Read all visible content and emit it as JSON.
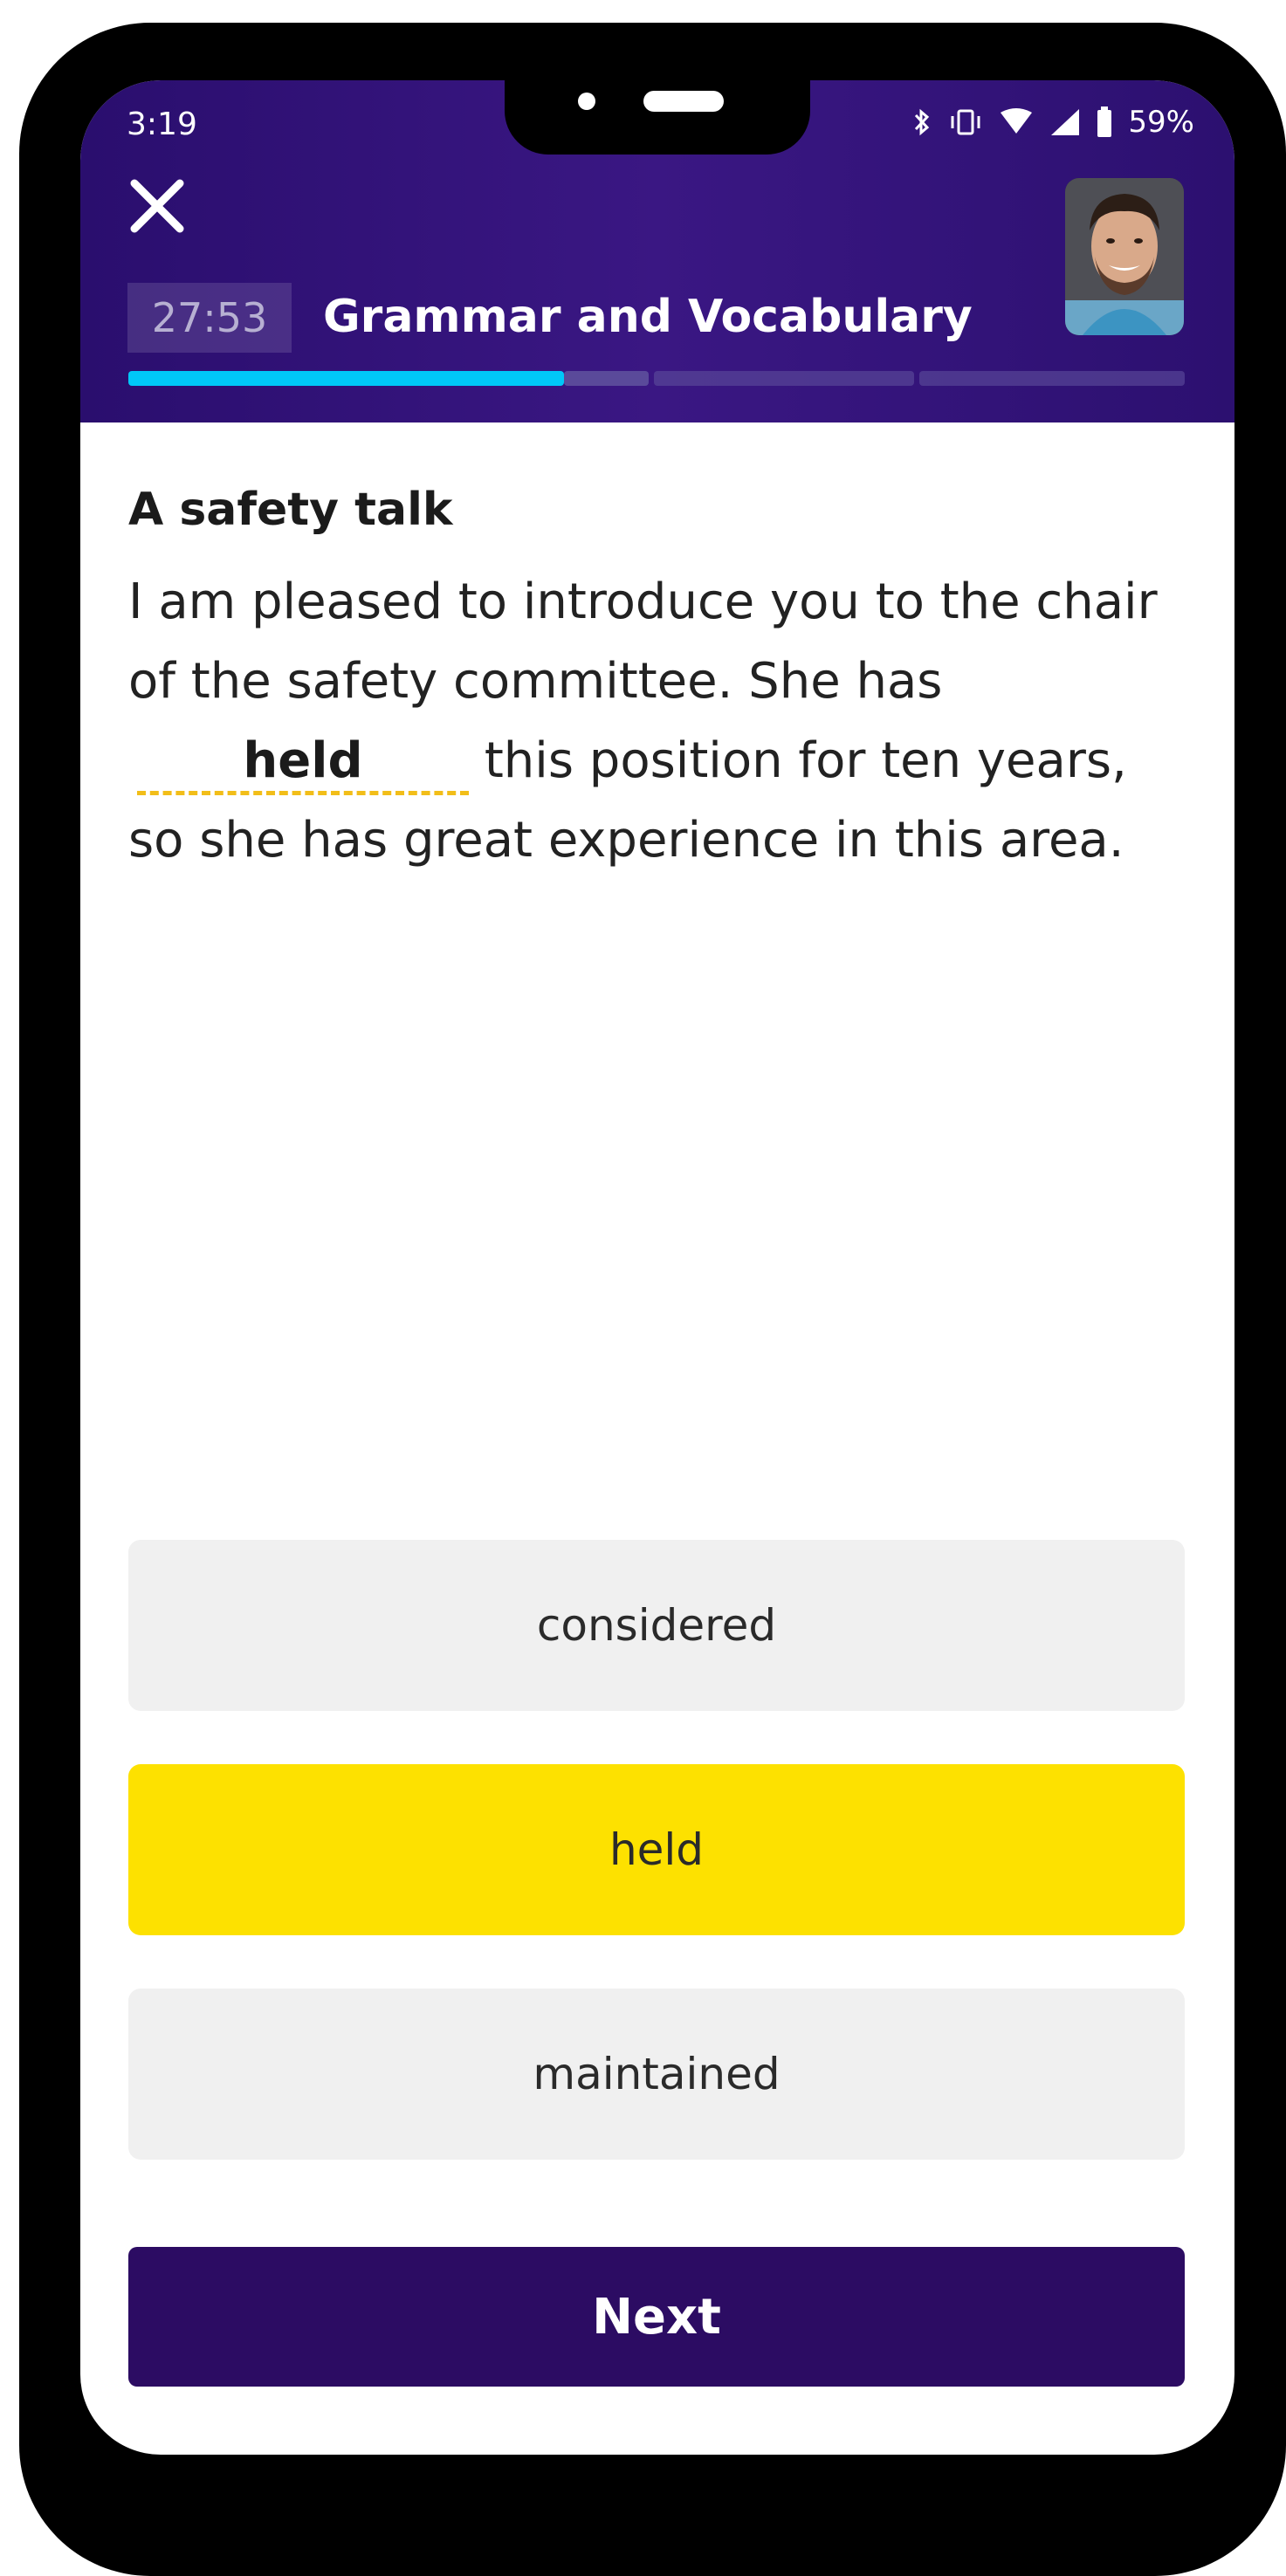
{
  "status_bar": {
    "time": "3:19",
    "battery": "59%",
    "icons": [
      "bluetooth-icon",
      "vibrate-icon",
      "wifi-icon",
      "signal-icon",
      "battery-icon"
    ]
  },
  "header": {
    "timer": "27:53",
    "section_title": "Grammar and Vocabulary",
    "progress": {
      "completed_fraction": 0.412,
      "segments": 4
    },
    "colors": {
      "background": "#2c1070",
      "progress_fill": "#00c8f8",
      "progress_track": "#5a4a9a"
    }
  },
  "question": {
    "title": "A safety talk",
    "text_before": "I am pleased to introduce you to the chair of the safety committee. She has",
    "answer": "held",
    "text_after": "this position for ten years, so she has great experience in this area."
  },
  "options": [
    {
      "label": "considered",
      "selected": false
    },
    {
      "label": "held",
      "selected": true
    },
    {
      "label": "maintained",
      "selected": false
    }
  ],
  "next_button": {
    "label": "Next"
  },
  "colors": {
    "selected_option": "#fde100",
    "option_bg": "#f0f0f0",
    "next_button": "#2c0c63"
  }
}
